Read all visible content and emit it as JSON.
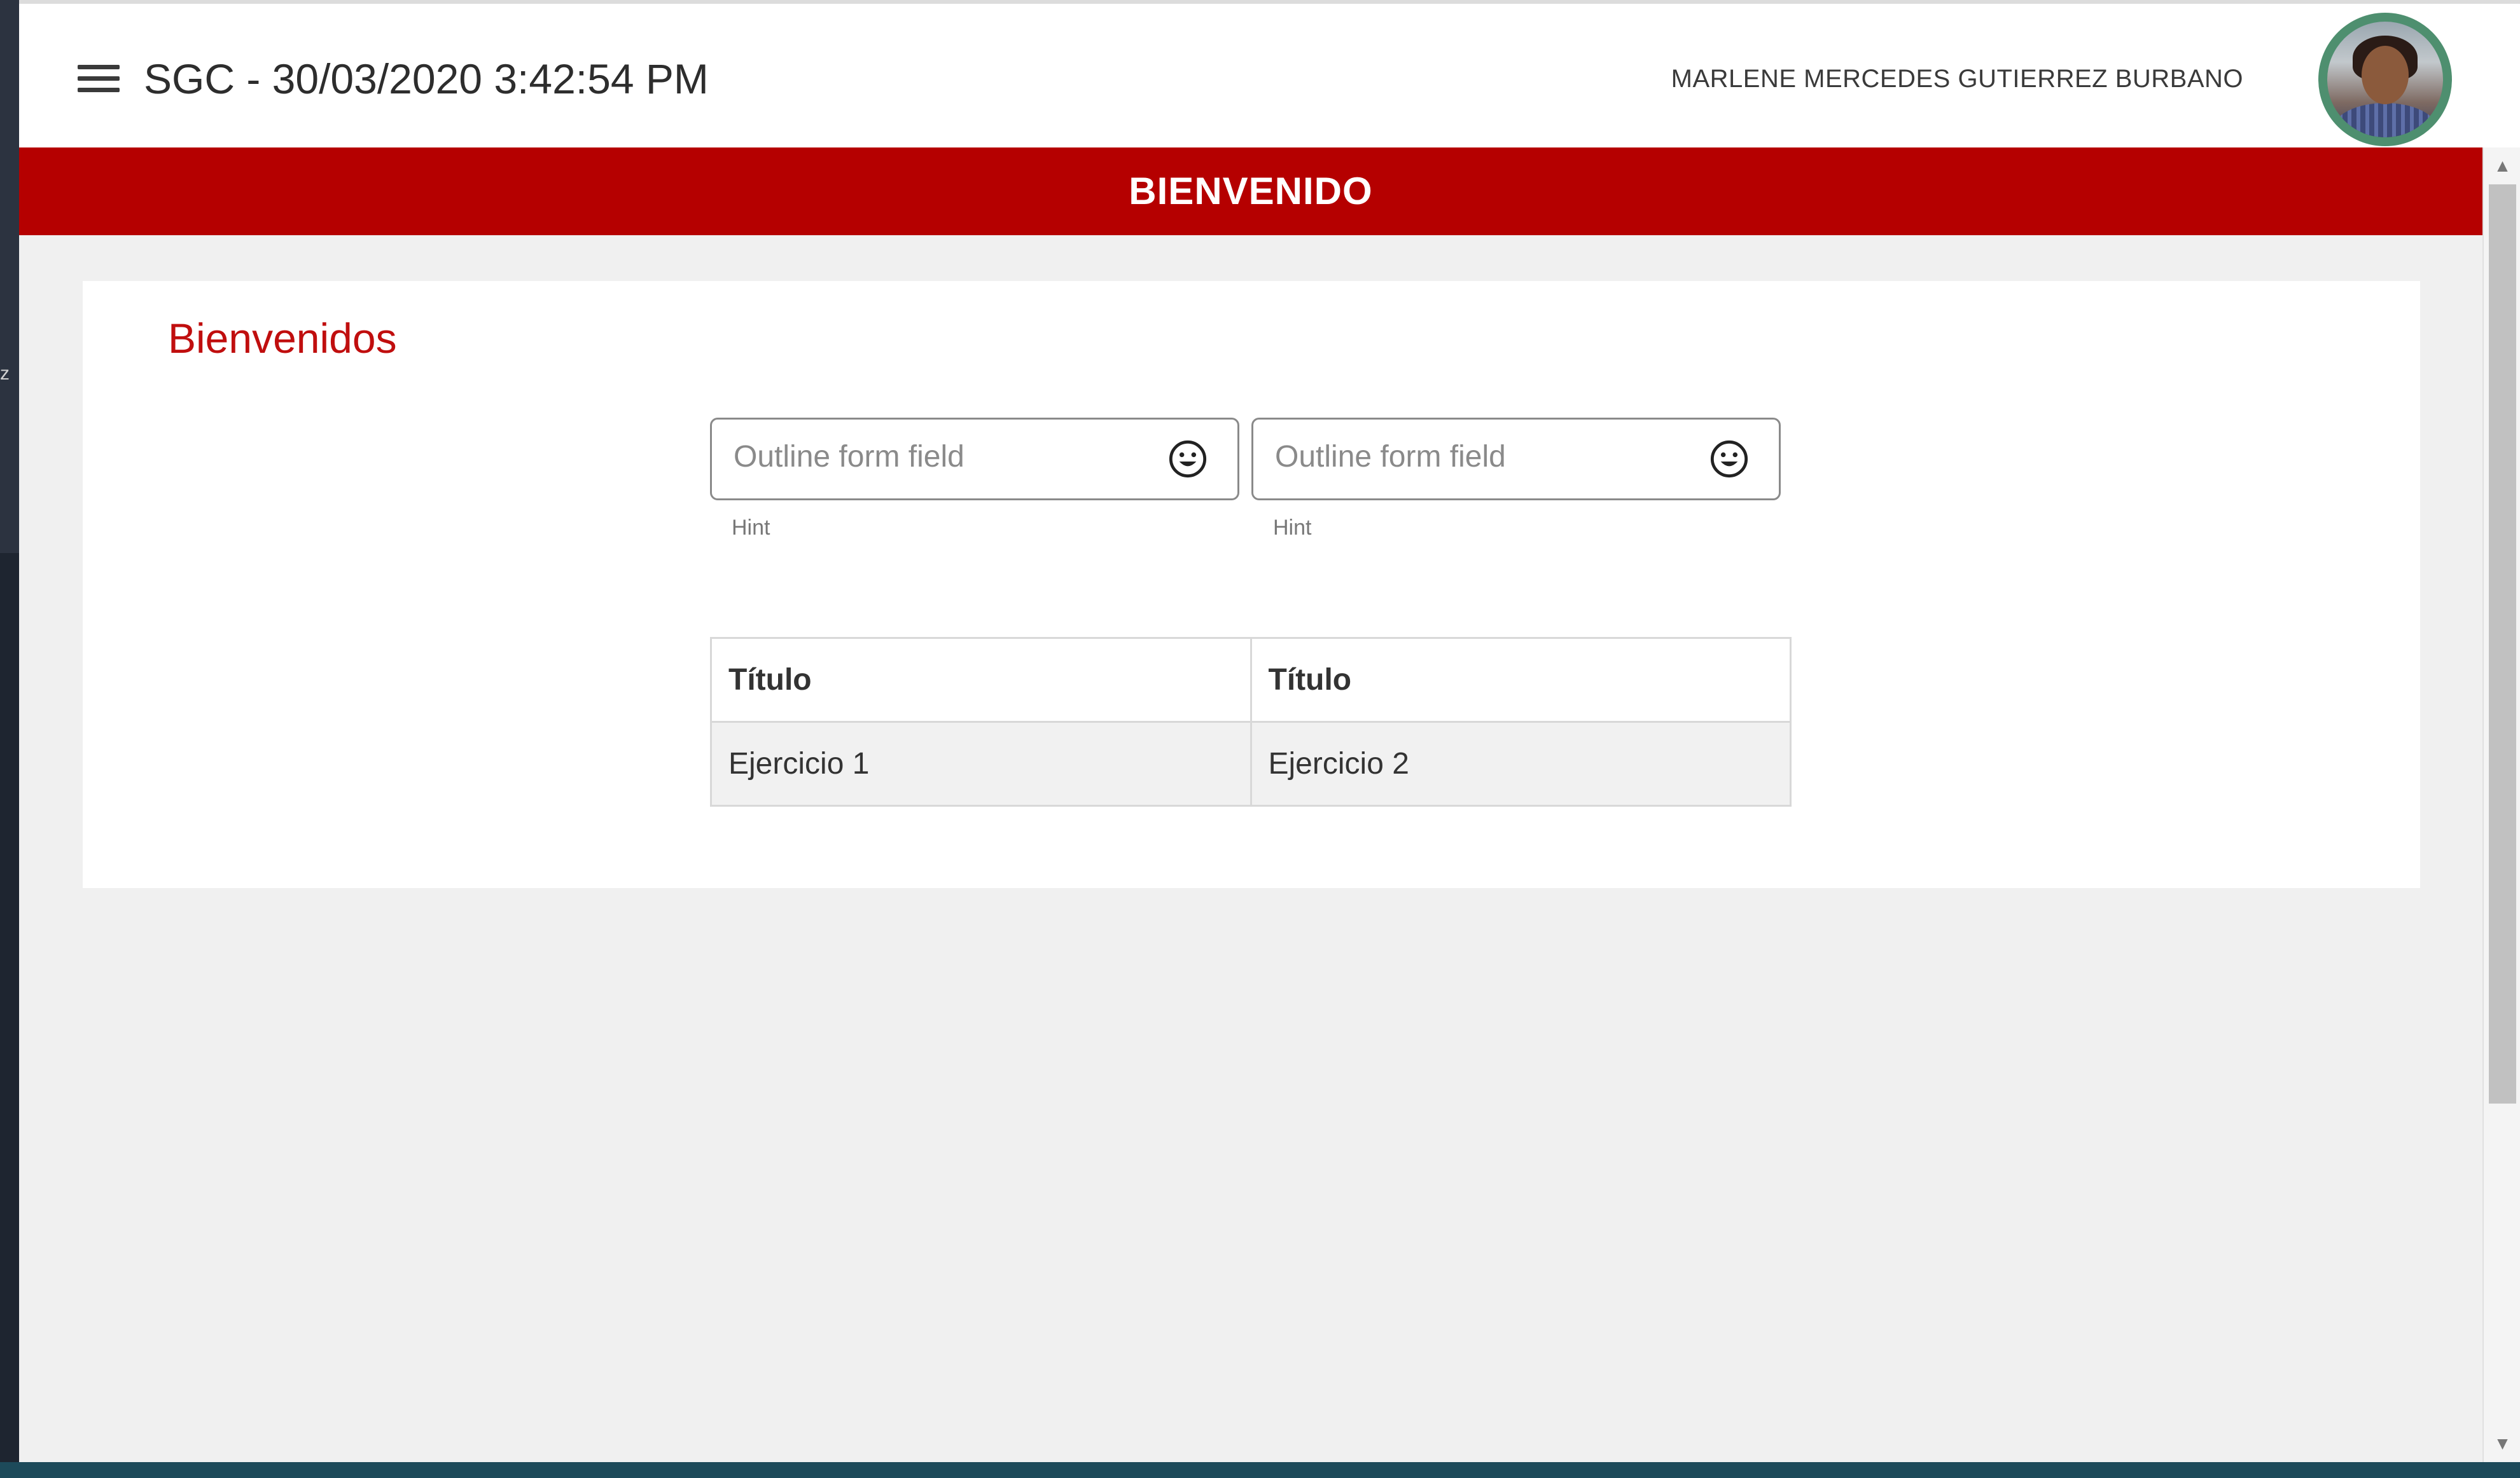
{
  "app_bar": {
    "title": "SGC - 30/03/2020 3:42:54 PM",
    "menu_icon": "hamburger-menu-icon",
    "user_name": "MARLENE MERCEDES GUTIERREZ BURBANO",
    "avatar_icon": "user-avatar"
  },
  "banner": {
    "title": "BIENVENIDO",
    "color": "#b50000"
  },
  "card": {
    "title": "Bienvenidos",
    "title_color": "#c00e0e",
    "fields": [
      {
        "placeholder": "Outline form field",
        "hint": "Hint",
        "icon": "smile-icon"
      },
      {
        "placeholder": "Outline form field",
        "hint": "Hint",
        "icon": "smile-icon"
      }
    ],
    "table": {
      "headers": [
        "Título",
        "Título"
      ],
      "rows": [
        [
          "Ejercicio 1",
          "Ejercicio 2"
        ]
      ]
    }
  },
  "scrollbar": {
    "up_icon": "scroll-up-arrow-icon",
    "down_icon": "scroll-down-arrow-icon"
  }
}
